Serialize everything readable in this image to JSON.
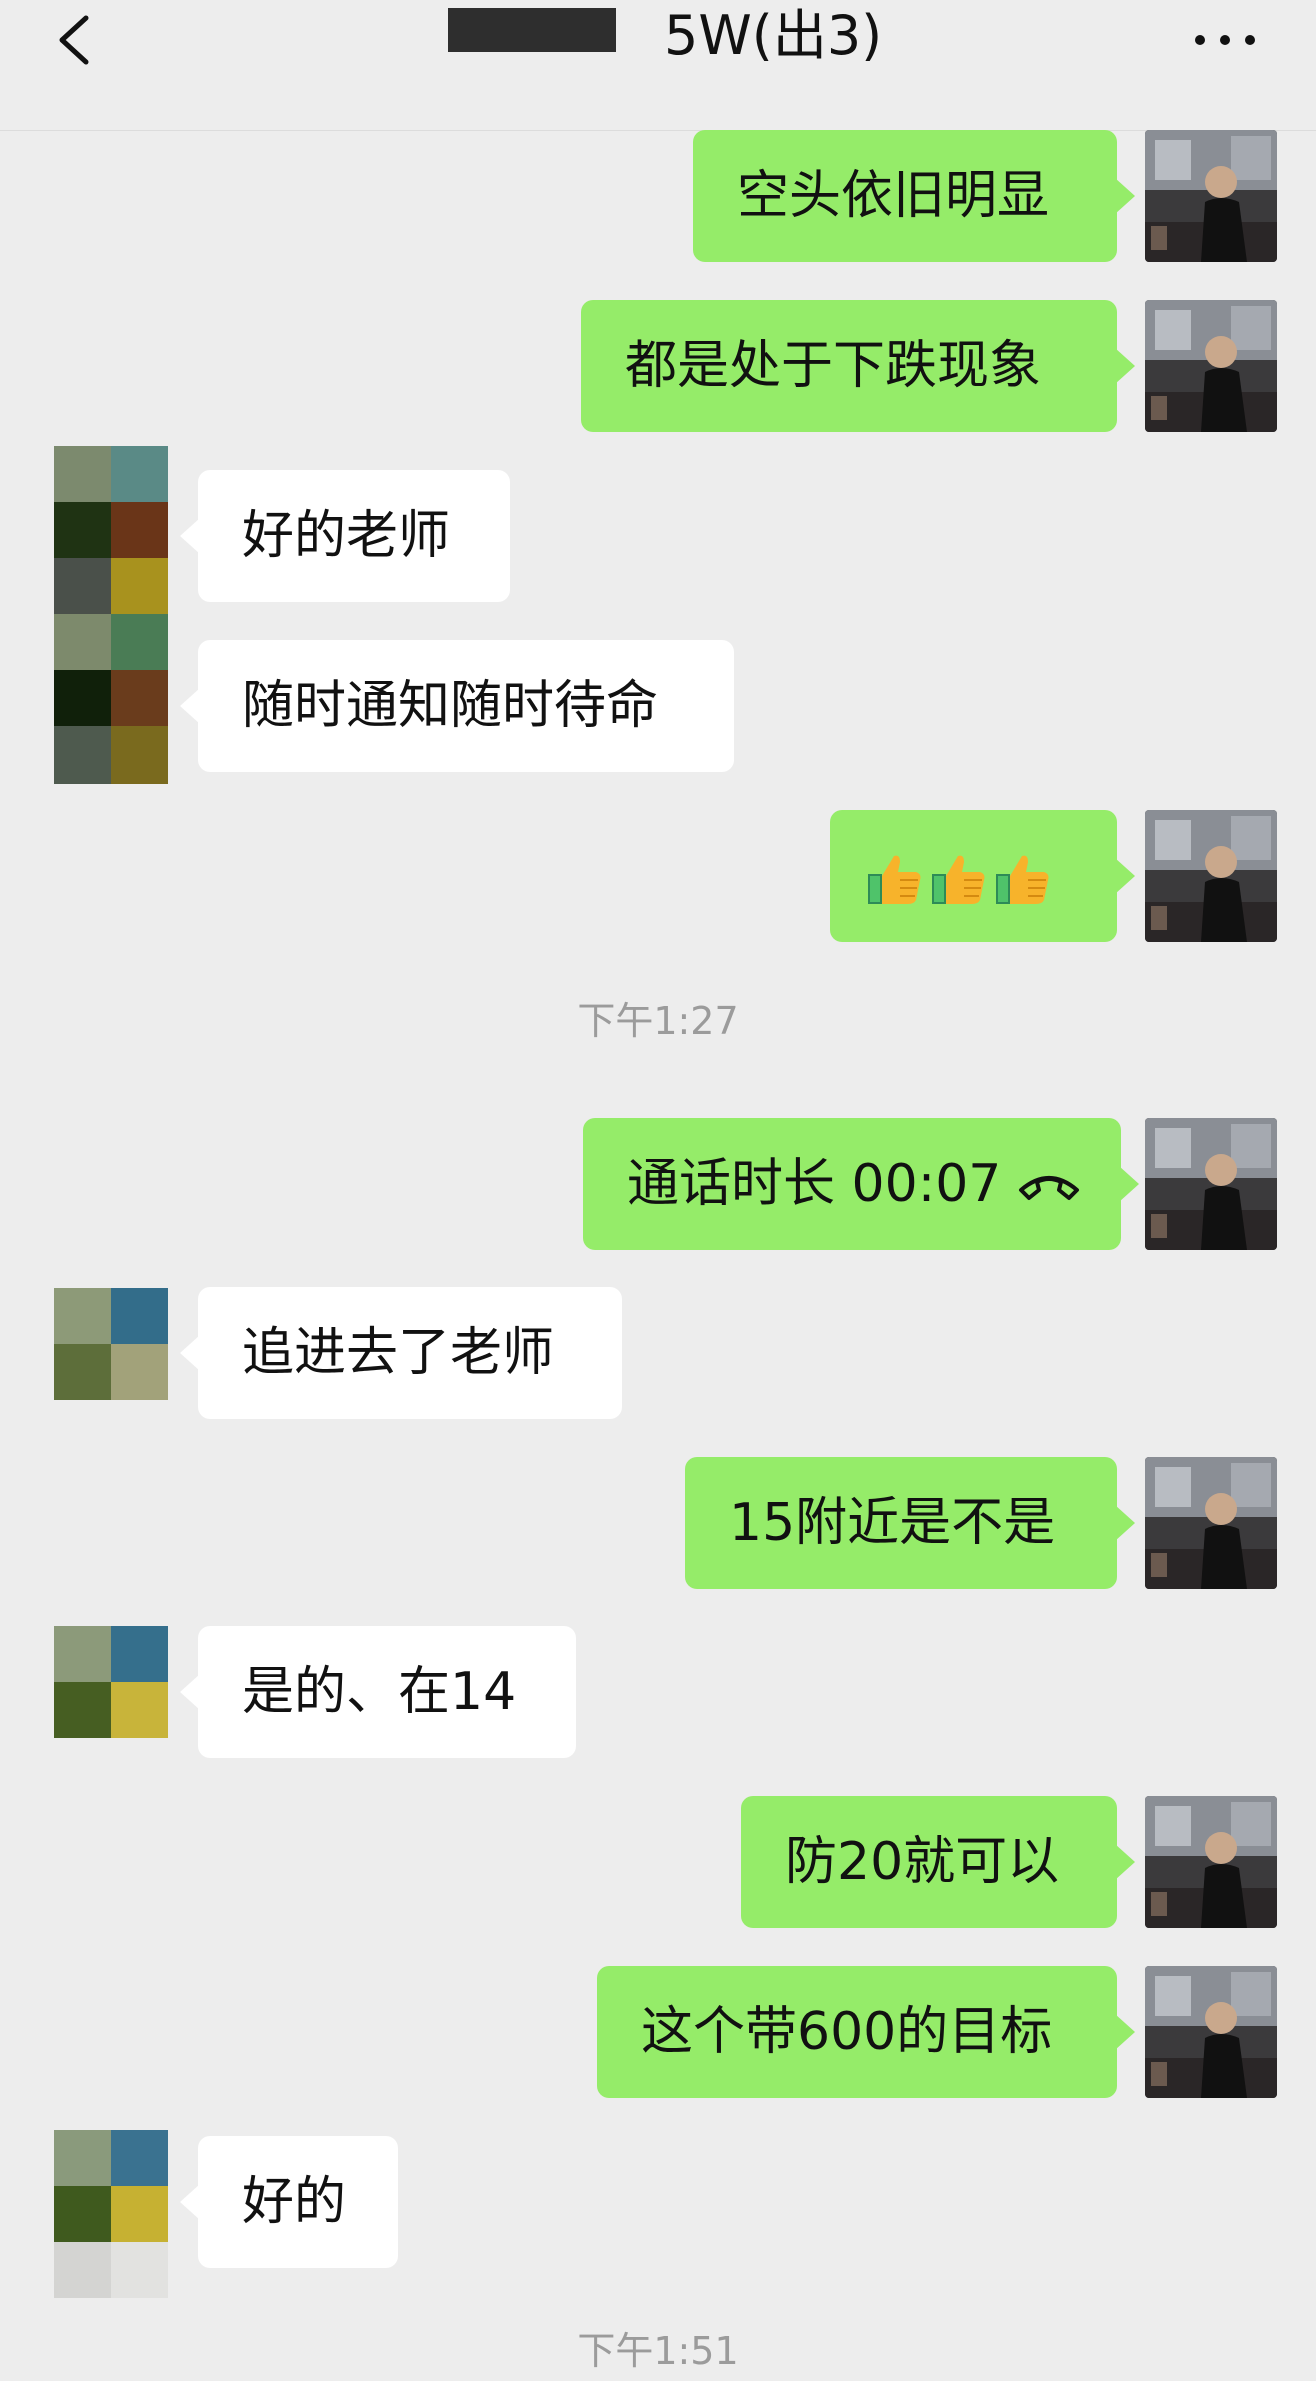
{
  "header": {
    "title": "5W(出3)",
    "back_icon": "chevron-left-icon",
    "more_icon": "more-icon"
  },
  "messages": [
    {
      "side": "out",
      "text": "空头依旧明显"
    },
    {
      "side": "out",
      "text": "都是处于下跌现象"
    },
    {
      "side": "in",
      "text": "好的老师"
    },
    {
      "side": "in",
      "text": "随时通知随时待命"
    },
    {
      "side": "out",
      "emoji": [
        "thumbs-up-icon",
        "thumbs-up-icon",
        "thumbs-up-icon"
      ]
    },
    {
      "type": "time",
      "text": "下午1:27"
    },
    {
      "side": "out",
      "text": "通话时长 00:07",
      "icon": "phone-hangup-icon"
    },
    {
      "side": "in",
      "text": "追进去了老师"
    },
    {
      "side": "out",
      "text": "15附近是不是"
    },
    {
      "side": "in",
      "text": "是的、在14"
    },
    {
      "side": "out",
      "text": "防20就可以"
    },
    {
      "side": "out",
      "text": "这个带600的目标"
    },
    {
      "side": "in",
      "text": "好的"
    },
    {
      "type": "time",
      "text": "下午1:51"
    }
  ],
  "colors": {
    "background": "#ededed",
    "outgoing_bubble": "#95ec69",
    "incoming_bubble": "#ffffff",
    "timestamp": "#9b9b9b"
  }
}
